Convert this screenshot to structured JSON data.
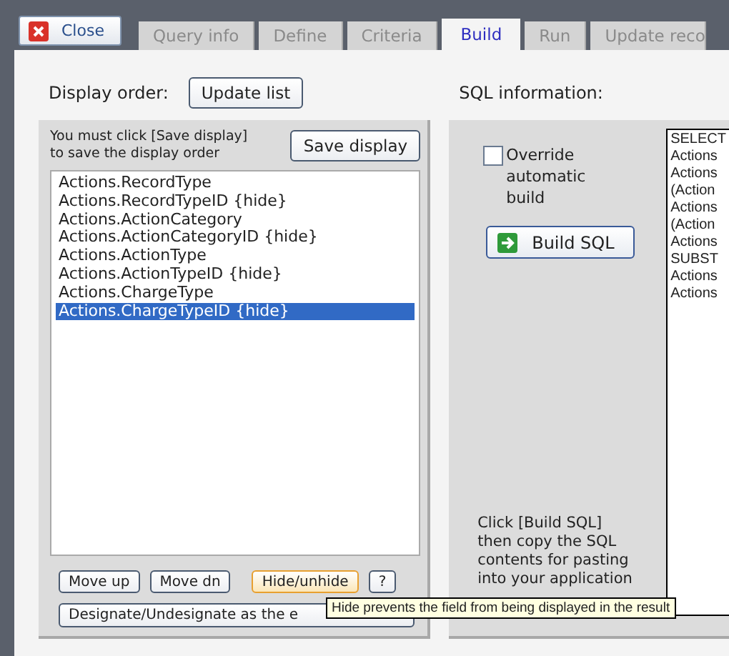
{
  "close_button": {
    "label": "Close"
  },
  "tabs": [
    {
      "label": "Query info",
      "selected": false
    },
    {
      "label": "Define",
      "selected": false
    },
    {
      "label": "Criteria",
      "selected": false
    },
    {
      "label": "Build",
      "selected": true
    },
    {
      "label": "Run",
      "selected": false
    },
    {
      "label": "Update reco",
      "selected": false
    }
  ],
  "display_order": {
    "label": "Display order:",
    "update_button": "Update list",
    "notice": "You must click [Save display] to save the display order",
    "save_button": "Save display",
    "items": [
      {
        "label": "Actions.RecordType",
        "selected": false
      },
      {
        "label": "Actions.RecordTypeID {hide}",
        "selected": false
      },
      {
        "label": "Actions.ActionCategory",
        "selected": false
      },
      {
        "label": "Actions.ActionCategoryID {hide}",
        "selected": false
      },
      {
        "label": "Actions.ActionType",
        "selected": false
      },
      {
        "label": "Actions.ActionTypeID {hide}",
        "selected": false
      },
      {
        "label": "Actions.ChargeType",
        "selected": false
      },
      {
        "label": "Actions.ChargeTypeID {hide}",
        "selected": true
      }
    ],
    "buttons": [
      "Move up",
      "Move dn",
      "Hide/unhide",
      "?"
    ],
    "designate_button": "Designate/Undesignate as the e"
  },
  "sql_information": {
    "label": "SQL information:",
    "override": {
      "label": "Override automatic build",
      "checked": false
    },
    "build_button": "Build SQL",
    "instructions": "Click [Build SQL] then copy the SQL contents for pasting into your application",
    "sql_lines": [
      "SELECT",
      "Actions",
      "Actions",
      "(Action",
      "Actions",
      "(Action",
      "Actions",
      "SUBST",
      "Actions",
      "Actions"
    ]
  },
  "tooltip": "Hide prevents the field from being displayed in the result"
}
